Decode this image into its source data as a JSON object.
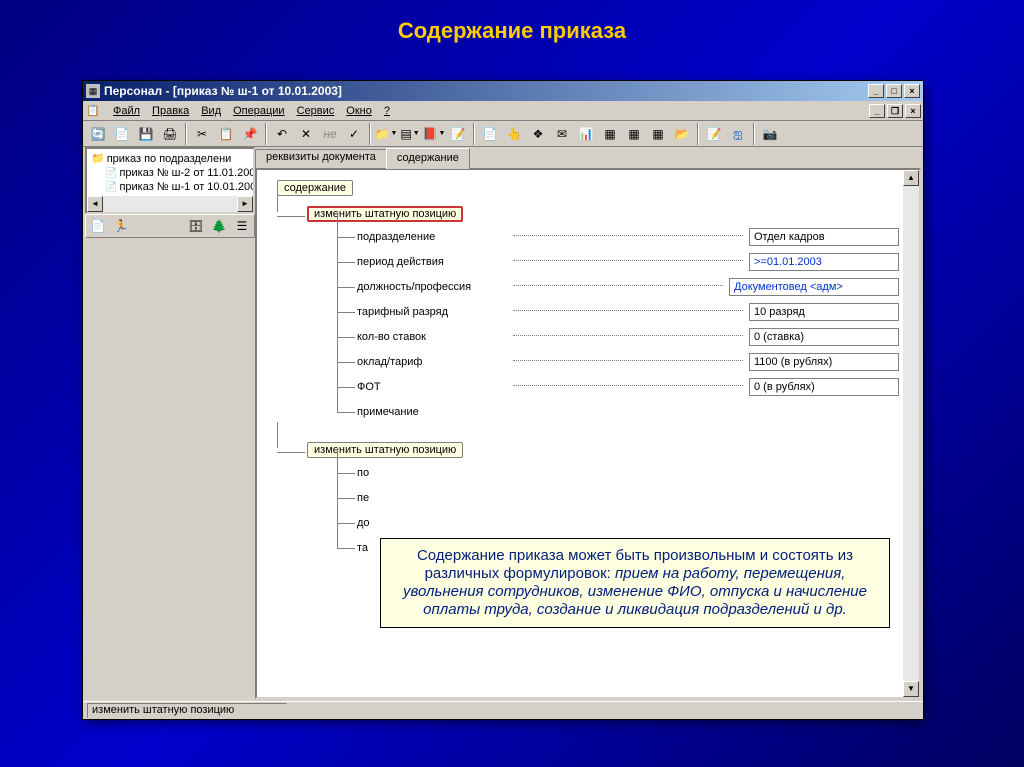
{
  "slide": {
    "title": "Содержание приказа"
  },
  "window": {
    "title": "Персонал - [приказ № ш-1 от 10.01.2003]"
  },
  "menu": {
    "file": "Файл",
    "edit": "Правка",
    "view": "Вид",
    "ops": "Операции",
    "service": "Сервис",
    "window": "Окно",
    "help": "?"
  },
  "tree": {
    "root": "приказ по подразделени",
    "items": [
      "приказ № ш-2 от 11.01.200",
      "приказ № ш-1 от 10.01.200"
    ]
  },
  "tabs": {
    "details": "реквизиты документа",
    "content": "содержание"
  },
  "outline": {
    "root": "содержание",
    "node1": "изменить штатную позицию",
    "node2": "изменить штатную позицию",
    "fields": [
      {
        "label": "подразделение",
        "value": "Отдел кадров",
        "link": false
      },
      {
        "label": "период действия",
        "value": ">=01.01.2003",
        "link": true
      },
      {
        "label": "должность/профессия",
        "value": "Документовед <адм>",
        "link": true,
        "wide": true
      },
      {
        "label": "тарифный разряд",
        "value": "10 разряд",
        "link": false
      },
      {
        "label": "кол-во ставок",
        "value": "0  (ставка)",
        "link": false
      },
      {
        "label": "оклад/тариф",
        "value": "1100  (в рублях)",
        "link": false
      },
      {
        "label": "ФОТ",
        "value": "0  (в рублях)",
        "link": false
      },
      {
        "label": "примечание",
        "value": "",
        "link": false,
        "empty": true
      }
    ],
    "partial": [
      "по",
      "пе",
      "до",
      "та"
    ]
  },
  "status": {
    "text": "изменить штатную позицию"
  },
  "tooltip": {
    "plain": "Содержание приказа может быть произвольным и состоять из различных формулировок: ",
    "italic": "прием на работу, перемещения, увольнения сотрудников, изменение ФИО, отпуска и начисление оплаты труда, создание и ликвидация подразделений и др."
  }
}
